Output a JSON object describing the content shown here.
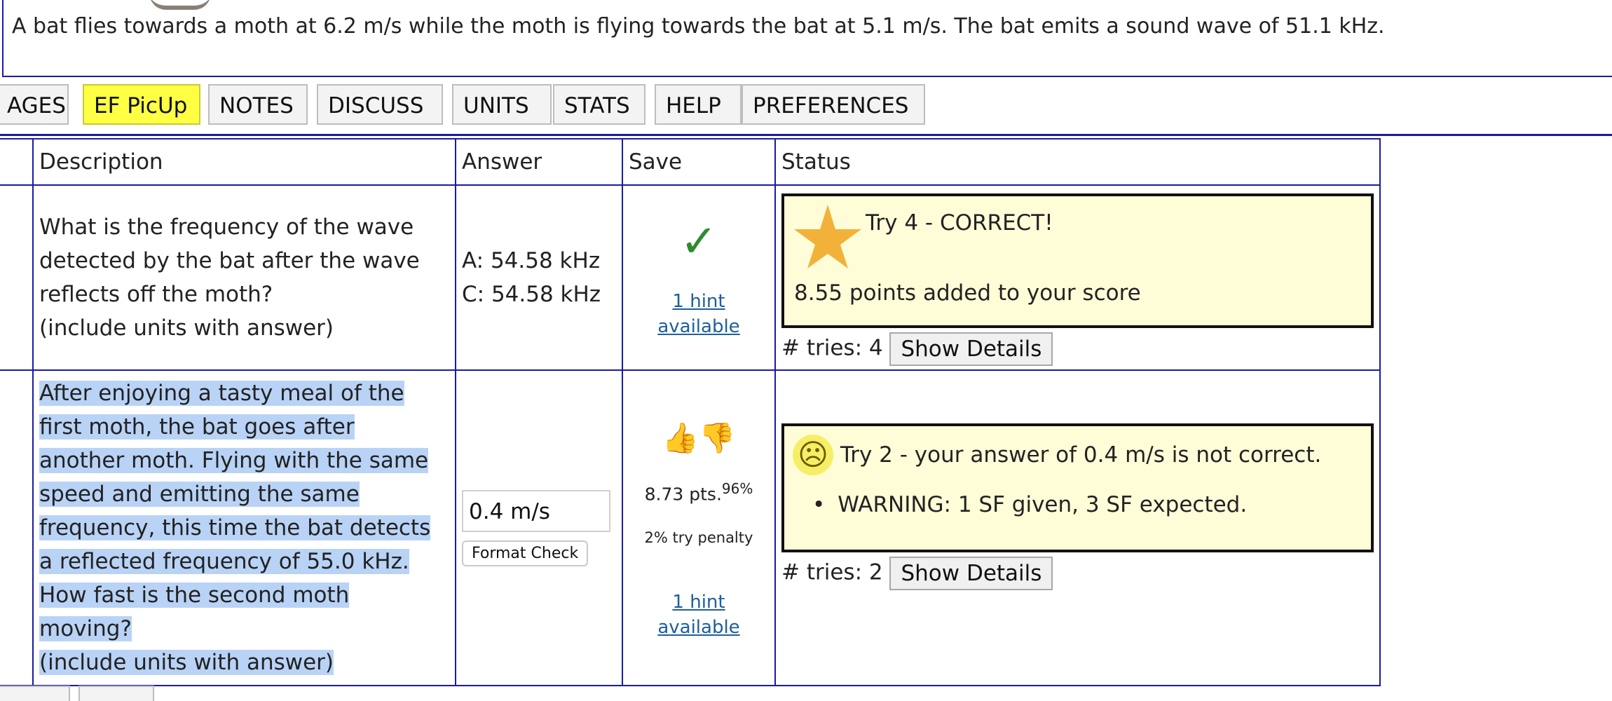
{
  "problem": {
    "text": "A bat flies towards a moth at 6.2 m/s while the moth is flying towards the bat at 5.1 m/s. The bat emits a sound wave of 51.1 kHz."
  },
  "tabs": [
    {
      "label": "AGES",
      "active": false
    },
    {
      "label": "EF PicUp",
      "active": true
    },
    {
      "label": "NOTES",
      "active": false
    },
    {
      "label": "DISCUSS",
      "active": false
    },
    {
      "label": "UNITS",
      "active": false
    },
    {
      "label": "STATS",
      "active": false
    },
    {
      "label": "HELP",
      "active": false
    },
    {
      "label": "PREFERENCES",
      "active": false
    }
  ],
  "table": {
    "headers": {
      "num": ":",
      "description": "Description",
      "answer": "Answer",
      "save": "Save",
      "status": "Status"
    },
    "rows": [
      {
        "description": [
          "What is the frequency of the wave",
          "detected by the bat after the wave",
          "reflects off the moth?",
          "(include units with answer)"
        ],
        "answer_lines": [
          "A: 54.58 kHz",
          "C: 54.58 kHz"
        ],
        "hint": "1 hint available",
        "status_title": "Try 4 - CORRECT!",
        "status_detail": "8.55 points added to your score",
        "tries_label": "# tries: 4",
        "details_button": "Show Details",
        "correct": true
      },
      {
        "description": [
          "After enjoying a tasty meal of the",
          "first moth, the bat goes after",
          "another moth. Flying with the same",
          "speed and emitting the same",
          "frequency, this time the bat detects",
          "a reflected frequency of 55.0 kHz.",
          "How fast is the second moth",
          "moving?",
          "(include units with answer)"
        ],
        "input_value": "0.4 m/s",
        "format_check": "Format Check",
        "points": "8.73 pts.",
        "points_pct": "96%",
        "penalty": "2% try penalty",
        "hint": "1 hint available",
        "status_title": "Try 2 - your answer of 0.4 m/s is not correct.",
        "warning": "WARNING: 1 SF given, 3 SF expected.",
        "tries_label": "# tries: 2",
        "details_button": "Show Details",
        "correct": false
      }
    ]
  },
  "colors": {
    "active_tab": "#ffff44",
    "table_border": "#1a1aa6",
    "status_bg": "#fffdd8",
    "highlight": "#b9d3f6",
    "correct_check": "#2e8b2e"
  }
}
